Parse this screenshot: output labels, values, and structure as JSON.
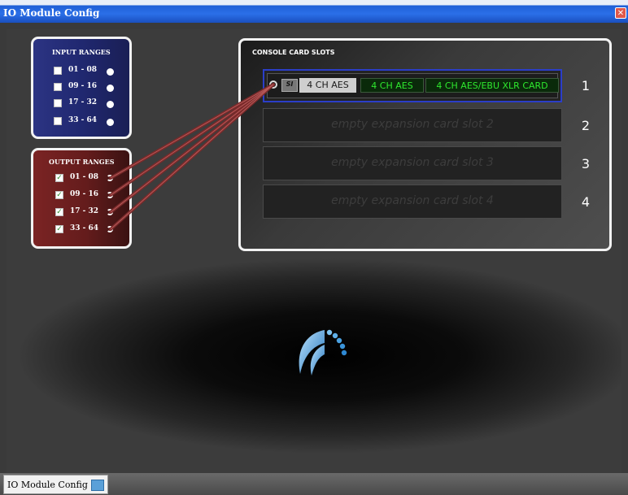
{
  "window": {
    "title": "IO Module Config",
    "close_glyph": "✕"
  },
  "input_ranges": {
    "title": "INPUT RANGES",
    "items": [
      {
        "label": "01 - 08",
        "checked": false
      },
      {
        "label": "09 - 16",
        "checked": false
      },
      {
        "label": "17 - 32",
        "checked": false
      },
      {
        "label": "33 - 64",
        "checked": false
      }
    ]
  },
  "output_ranges": {
    "title": "OUTPUT RANGES",
    "items": [
      {
        "label": "01 - 08",
        "checked": true
      },
      {
        "label": "09 - 16",
        "checked": true
      },
      {
        "label": "17 - 32",
        "checked": true
      },
      {
        "label": "33 - 64",
        "checked": true
      }
    ],
    "check_glyph": "✓"
  },
  "console": {
    "title": "CONSOLE CARD SLOTS",
    "slot1": {
      "logo_text": "SI",
      "chips": [
        "4 CH AES",
        "4 CH AES",
        "4 CH AES/EBU XLR CARD"
      ],
      "number": "1"
    },
    "slots": [
      {
        "text": "empty expansion card slot 2",
        "number": "2"
      },
      {
        "text": "empty expansion card slot 3",
        "number": "3"
      },
      {
        "text": "empty expansion card slot 4",
        "number": "4"
      }
    ]
  },
  "taskbar": {
    "tab_label": "IO Module Config"
  },
  "colors": {
    "titlebar": "#2b6fe8",
    "input_panel": "#202870",
    "output_panel": "#641c1c",
    "slot_selected_border": "#2b3ec8",
    "chip_green_text": "#2ee82e",
    "wire": "#7a2a2a"
  }
}
